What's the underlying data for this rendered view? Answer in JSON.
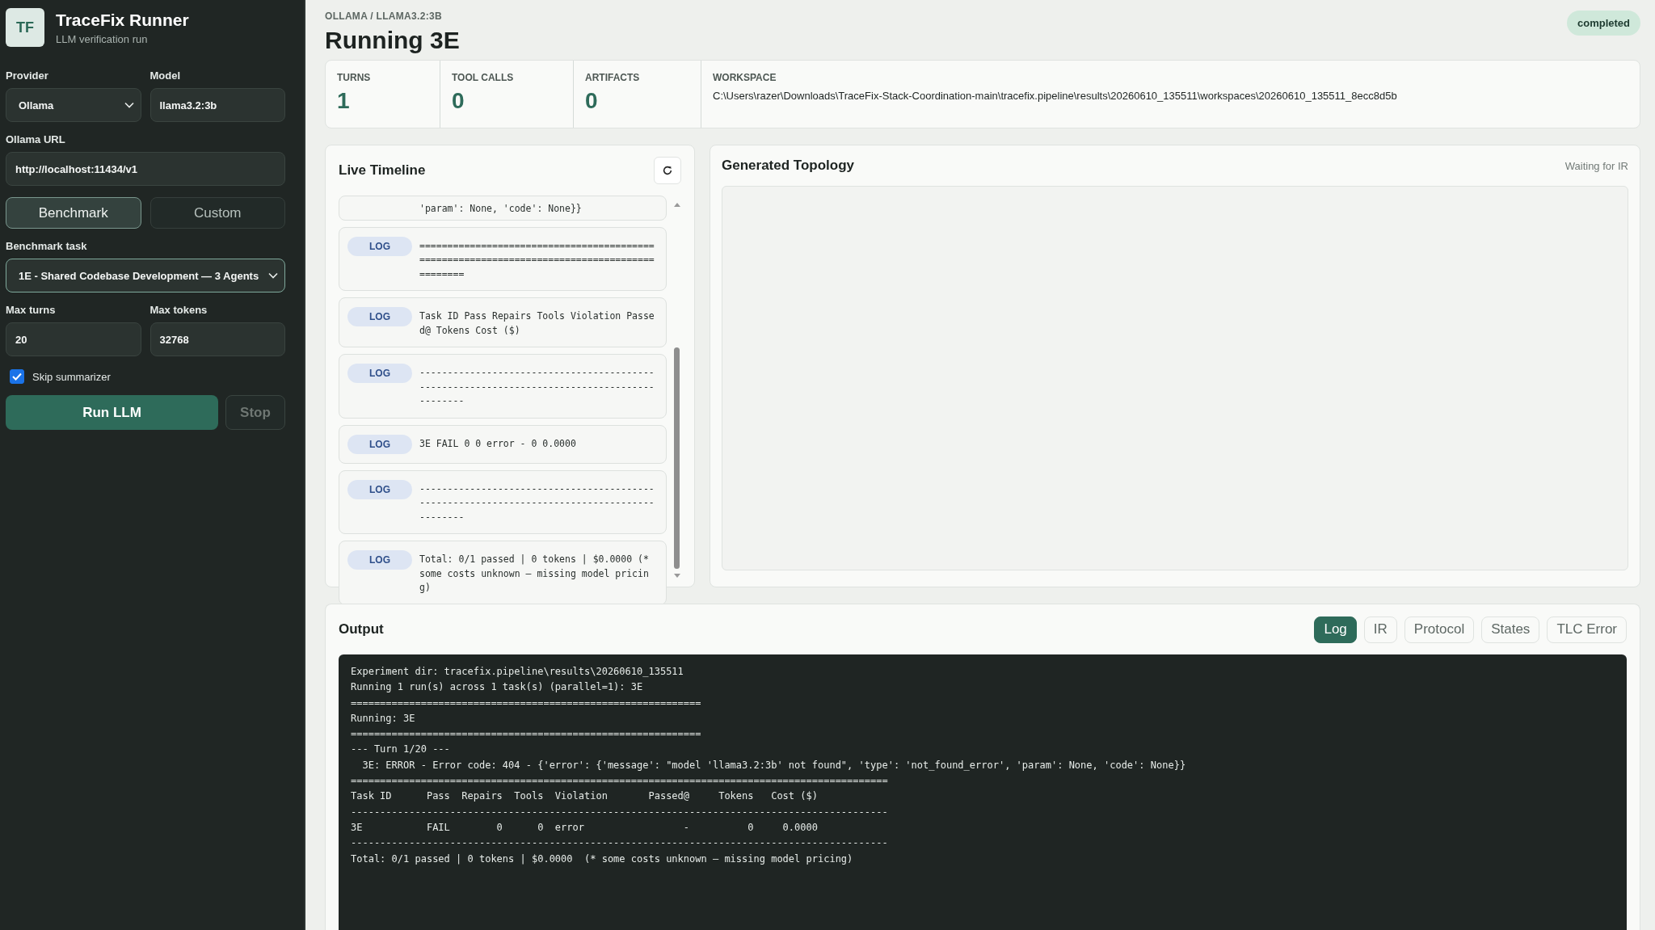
{
  "app": {
    "logo": "TF",
    "title": "TraceFix Runner",
    "subtitle": "LLM verification run"
  },
  "form": {
    "provider": {
      "label": "Provider",
      "value": "Ollama"
    },
    "model": {
      "label": "Model",
      "value": "llama3.2:3b"
    },
    "ollama_url": {
      "label": "Ollama URL",
      "value": "http://localhost:11434/v1"
    },
    "modes": [
      {
        "label": "Benchmark",
        "selected": true
      },
      {
        "label": "Custom",
        "selected": false
      }
    ],
    "benchmark_task": {
      "label": "Benchmark task",
      "value": "1E - Shared Codebase Development — 3 Agents"
    },
    "max_turns": {
      "label": "Max turns",
      "value": "20"
    },
    "max_tokens": {
      "label": "Max tokens",
      "value": "32768"
    },
    "skip_summarizer": {
      "label": "Skip summarizer",
      "checked": true
    }
  },
  "run_button": {
    "label": "Run LLM"
  },
  "stop_button": {
    "label": "Stop",
    "disabled": true
  },
  "header": {
    "breadcrumb": "OLLAMA / LLAMA3.2:3B",
    "title": "Running 3E",
    "status": "completed"
  },
  "stats": [
    {
      "label": "TURNS",
      "value": "1"
    },
    {
      "label": "TOOL CALLS",
      "value": "0"
    },
    {
      "label": "ARTIFACTS",
      "value": "0"
    }
  ],
  "workspace": {
    "label": "WORKSPACE",
    "value": "C:\\Users\\razer\\Downloads\\TraceFix-Stack-Coordination-main\\tracefix.pipeline\\results\\20260610_135511\\workspaces\\20260610_135511_8ecc8d5b"
  },
  "timeline": {
    "title": "Live Timeline",
    "entries": [
      {
        "text": "'param': None, 'code': None}}"
      },
      {
        "tag": "LOG",
        "text": "============================================================================================"
      },
      {
        "tag": "LOG",
        "text": "Task ID Pass Repairs Tools Violation Passed@ Tokens Cost ($)"
      },
      {
        "tag": "LOG",
        "text": "--------------------------------------------------------------------------------------------"
      },
      {
        "tag": "LOG",
        "text": "3E FAIL 0 0 error - 0 0.0000"
      },
      {
        "tag": "LOG",
        "text": "--------------------------------------------------------------------------------------------"
      },
      {
        "tag": "LOG",
        "text": "Total: 0/1 passed | 0 tokens | $0.0000 (* some costs unknown — missing model pricing)"
      }
    ]
  },
  "topology": {
    "title": "Generated Topology",
    "status": "Waiting for IR"
  },
  "output": {
    "title": "Output",
    "tabs": [
      {
        "label": "Log",
        "selected": true
      },
      {
        "label": "IR",
        "selected": false
      },
      {
        "label": "Protocol",
        "selected": false
      },
      {
        "label": "States",
        "selected": false
      },
      {
        "label": "TLC Error",
        "selected": false
      }
    ],
    "lines": [
      "Experiment dir: tracefix.pipeline\\results\\20260610_135511",
      "Running 1 run(s) across 1 task(s) (parallel=1): 3E",
      "============================================================",
      "Running: 3E",
      "============================================================",
      "--- Turn 1/20 ---",
      "  3E: ERROR - Error code: 404 - {'error': {'message': \"model 'llama3.2:3b' not found\", 'type': 'not_found_error', 'param': None, 'code': None}}",
      "============================================================================================",
      "Task ID      Pass  Repairs  Tools  Violation       Passed@     Tokens   Cost ($)",
      "--------------------------------------------------------------------------------------------",
      "3E           FAIL        0      0  error                 -          0     0.0000",
      "--------------------------------------------------------------------------------------------",
      "Total: 0/1 passed | 0 tokens | $0.0000  (* some costs unknown — missing model pricing)"
    ]
  }
}
